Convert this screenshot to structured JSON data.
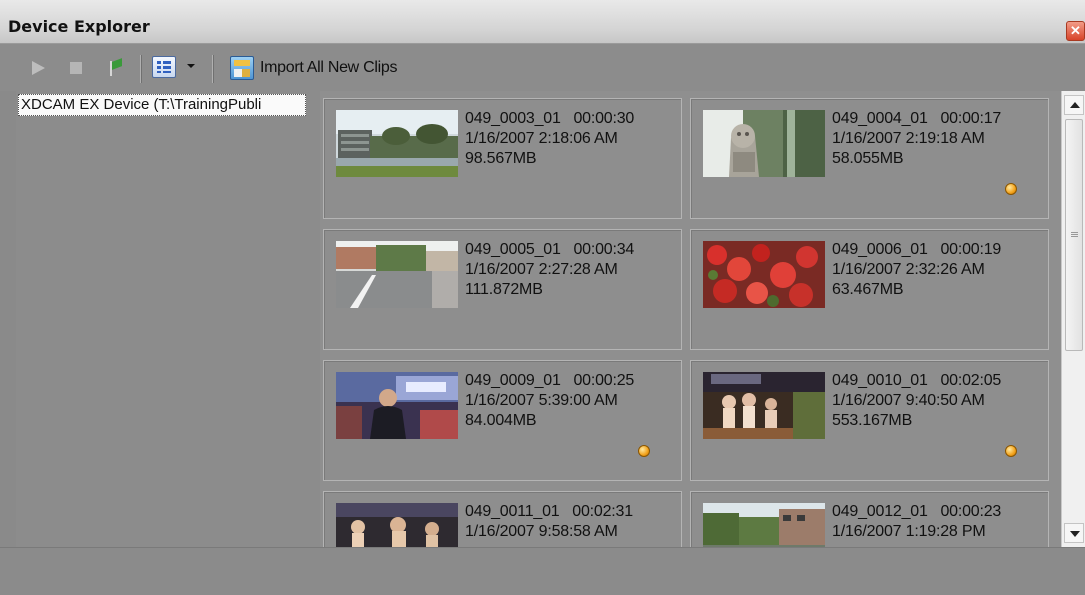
{
  "window": {
    "title": "Device Explorer"
  },
  "toolbar": {
    "import_label": "Import All New Clips"
  },
  "tree": {
    "device_label": "XDCAM EX Device (T:\\TrainingPubli"
  },
  "clips": [
    {
      "name": "049_0003_01",
      "duration": "00:00:30",
      "datetime": "1/16/2007 2:18:06 AM",
      "size": "98.567MB",
      "new": false
    },
    {
      "name": "049_0004_01",
      "duration": "00:00:17",
      "datetime": "1/16/2007 2:19:18 AM",
      "size": "58.055MB",
      "new": true
    },
    {
      "name": "049_0005_01",
      "duration": "00:00:34",
      "datetime": "1/16/2007 2:27:28 AM",
      "size": "111.872MB",
      "new": false
    },
    {
      "name": "049_0006_01",
      "duration": "00:00:19",
      "datetime": "1/16/2007 2:32:26 AM",
      "size": "63.467MB",
      "new": false
    },
    {
      "name": "049_0009_01",
      "duration": "00:00:25",
      "datetime": "1/16/2007 5:39:00 AM",
      "size": "84.004MB",
      "new": true
    },
    {
      "name": "049_0010_01",
      "duration": "00:02:05",
      "datetime": "1/16/2007 9:40:50 AM",
      "size": "553.167MB",
      "new": true
    },
    {
      "name": "049_0011_01",
      "duration": "00:02:31",
      "datetime": "1/16/2007 9:58:58 AM",
      "size": "",
      "new": false
    },
    {
      "name": "049_0012_01",
      "duration": "00:00:23",
      "datetime": "1/16/2007 1:19:28 PM",
      "size": "",
      "new": false
    }
  ]
}
